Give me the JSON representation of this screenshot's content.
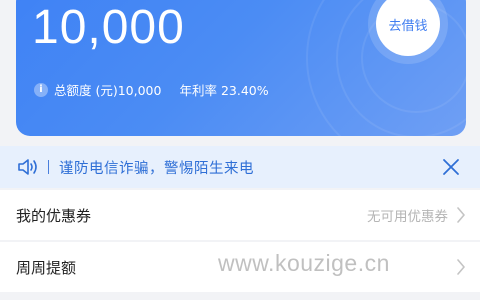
{
  "card": {
    "amount": "10,000",
    "borrow_button": "去借钱",
    "total_limit": "总额度 (元)10,000",
    "annual_rate": "年利率 23.40%"
  },
  "notice": {
    "text": "谨防电信诈骗，警惕陌生来电"
  },
  "rows": [
    {
      "label": "我的优惠券",
      "value": "无可用优惠券"
    },
    {
      "label": "周周提额",
      "value": ""
    }
  ],
  "watermark": "www.kouzige.cn",
  "colors": {
    "card_gradient_start": "#3f82f5",
    "card_gradient_end": "#6f9ff4",
    "notice_bg": "#e7f0fd",
    "notice_text": "#2f6fd6"
  }
}
